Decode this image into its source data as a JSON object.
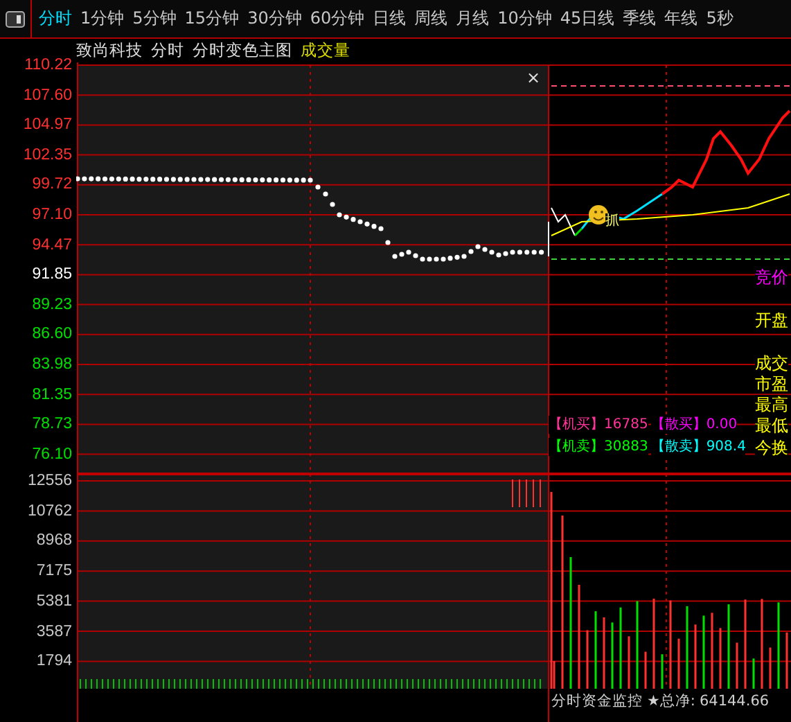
{
  "toolbar": {
    "tabs": [
      {
        "label": "分时",
        "selected": true
      },
      {
        "label": "1分钟",
        "selected": false
      },
      {
        "label": "5分钟",
        "selected": false
      },
      {
        "label": "15分钟",
        "selected": false
      },
      {
        "label": "30分钟",
        "selected": false
      },
      {
        "label": "60分钟",
        "selected": false
      },
      {
        "label": "日线",
        "selected": false
      },
      {
        "label": "周线",
        "selected": false
      },
      {
        "label": "月线",
        "selected": false
      },
      {
        "label": "10分钟",
        "selected": false
      },
      {
        "label": "45日线",
        "selected": false
      },
      {
        "label": "季线",
        "selected": false
      },
      {
        "label": "年线",
        "selected": false
      },
      {
        "label": "5秒",
        "selected": false
      }
    ]
  },
  "header": {
    "stock_name": "致尚科技",
    "period": "分时",
    "main_chart": "分时变色主图",
    "indicator": "成交量"
  },
  "price_axis": [
    {
      "label": "110.22",
      "color": "#ff3030"
    },
    {
      "label": "107.60",
      "color": "#ff3030"
    },
    {
      "label": "104.97",
      "color": "#ff3030"
    },
    {
      "label": "102.35",
      "color": "#ff3030"
    },
    {
      "label": "99.72",
      "color": "#ff3030"
    },
    {
      "label": "97.10",
      "color": "#ff3030"
    },
    {
      "label": "94.47",
      "color": "#ff3030"
    },
    {
      "label": "91.85",
      "color": "#ffffff"
    },
    {
      "label": "89.23",
      "color": "#00e000"
    },
    {
      "label": "86.60",
      "color": "#00e000"
    },
    {
      "label": "83.98",
      "color": "#00e000"
    },
    {
      "label": "81.35",
      "color": "#00e000"
    },
    {
      "label": "78.73",
      "color": "#00e000"
    },
    {
      "label": "76.10",
      "color": "#00e000"
    }
  ],
  "volume_axis": [
    "12556",
    "10762",
    "8968",
    "7175",
    "5381",
    "3587",
    "1794"
  ],
  "close_button": "×",
  "signal_mark": "抓",
  "quote_labels": [
    {
      "label": "竞价",
      "color": "#ff00ff"
    },
    {
      "label": "开盘",
      "color": "#ffff00"
    },
    {
      "label": "成交",
      "color": "#ffff00"
    },
    {
      "label": "市盈",
      "color": "#ffff00"
    },
    {
      "label": "最高",
      "color": "#ffff00"
    },
    {
      "label": "最低",
      "color": "#ffff00"
    },
    {
      "label": "今换",
      "color": "#ffff00"
    }
  ],
  "fund_flow": [
    {
      "label": "【机买】",
      "value": "16785",
      "color": "#ff3399"
    },
    {
      "label": "【散买】",
      "value": "0.00",
      "color": "#ff00ff"
    },
    {
      "label": "【机卖】",
      "value": "30883",
      "color": "#00ff00"
    },
    {
      "label": "【散卖】",
      "value": "908.4",
      "color": "#00ffff"
    }
  ],
  "status": {
    "title": "分时资金监控",
    "total_net_label": "★总净:",
    "total_net": "64144.66"
  }
}
